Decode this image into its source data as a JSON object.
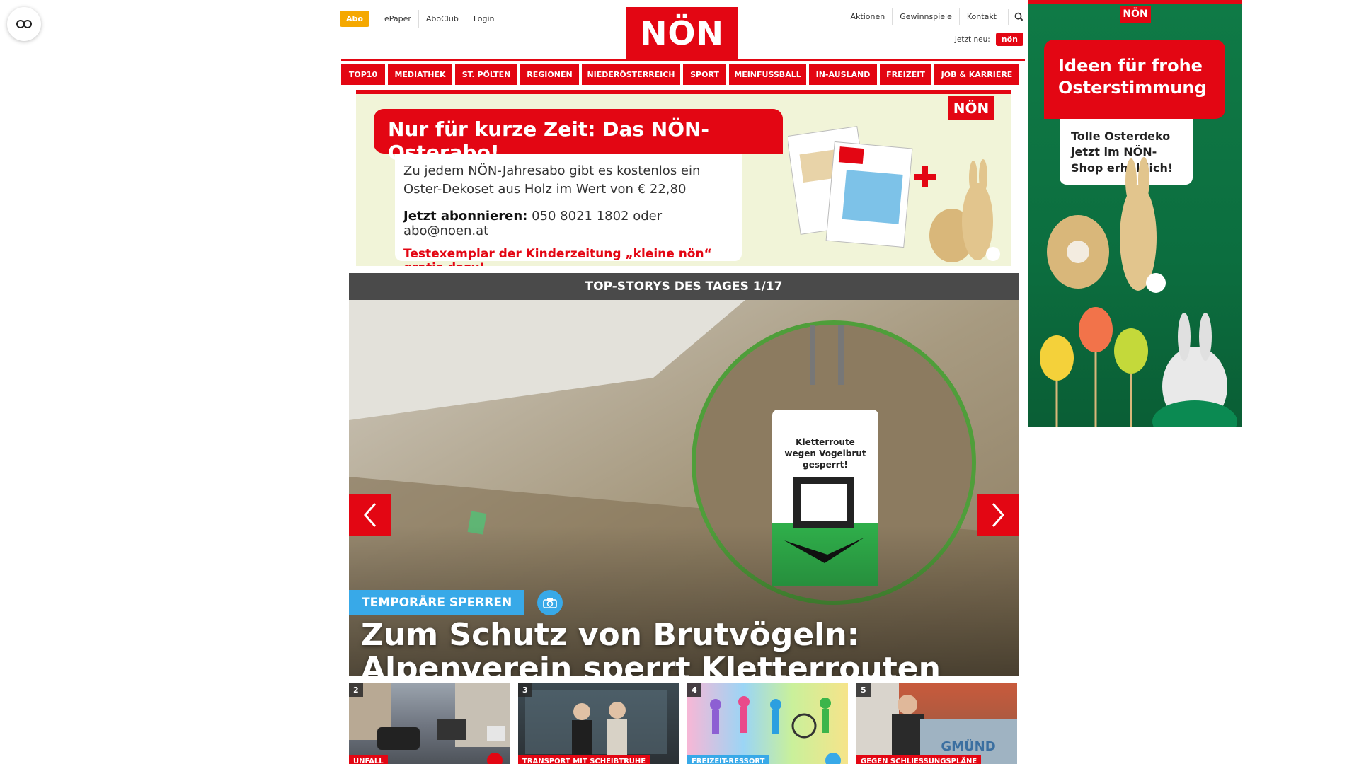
{
  "header": {
    "abo_label": "Abo",
    "links_left": [
      "ePaper",
      "AboClub",
      "Login"
    ],
    "logo_text": "NÖN",
    "links_right": [
      "Aktionen",
      "Gewinnspiele",
      "Kontakt"
    ],
    "jetzt_neu_label": "Jetzt neu:",
    "kleine_badge": "nön"
  },
  "nav": {
    "items": [
      "TOP10",
      "MEDIATHEK",
      "ST. PÖLTEN",
      "REGIONEN",
      "NIEDERÖSTERREICH",
      "SPORT",
      "MEINFUSSBALL",
      "IN-AUSLAND",
      "FREIZEIT",
      "JOB & KARRIERE"
    ]
  },
  "promo": {
    "logo_text": "NÖN",
    "headline": "Nur für kurze Zeit: Das NÖN-Osterabo!",
    "text_line1": "Zu jedem NÖN-Jahresabo gibt es kostenlos ein",
    "text_line2": "Oster-Dekoset aus Holz im Wert von € 22,80",
    "cta_bold": "Jetzt abonnieren:",
    "cta_rest": "050 8021 1802 oder abo@noen.at",
    "note": "Testexemplar der Kinderzeitung „kleine nön“ gratis dazu!"
  },
  "slider": {
    "header": "TOP-STORYS DES TAGES 1/17",
    "tag": "TEMPORÄRE SPERREN",
    "title": "Zum Schutz von Brutvögeln: Alpenverein sperrt Kletterrouten",
    "sign_text": "Kletterroute wegen Vogelbrut gesperrt!"
  },
  "thumbs": [
    {
      "num": "2",
      "tag": "UNFALL"
    },
    {
      "num": "3",
      "tag": "TRANSPORT MIT SCHEIBTRUHE"
    },
    {
      "num": "4",
      "tag": "FREIZEIT-RESSORT"
    },
    {
      "num": "5",
      "tag": "GEGEN SCHLIESSUNGSPLÄNE"
    }
  ],
  "ad": {
    "logo_text": "NÖN",
    "headline": "Ideen für frohe Osterstimmung",
    "card_text": "Tolle Osterdeko jetzt im NÖN-Shop erhältlich!"
  },
  "colors": {
    "brand_red": "#e30613",
    "accent_blue": "#38a9e8",
    "abo_orange": "#f5a800",
    "ad_green": "#0f7a46",
    "slider_header": "#4a4a4a"
  },
  "icons": [
    "accessibility-icon",
    "search-icon",
    "chevron-left-icon",
    "chevron-right-icon",
    "camera-icon"
  ]
}
